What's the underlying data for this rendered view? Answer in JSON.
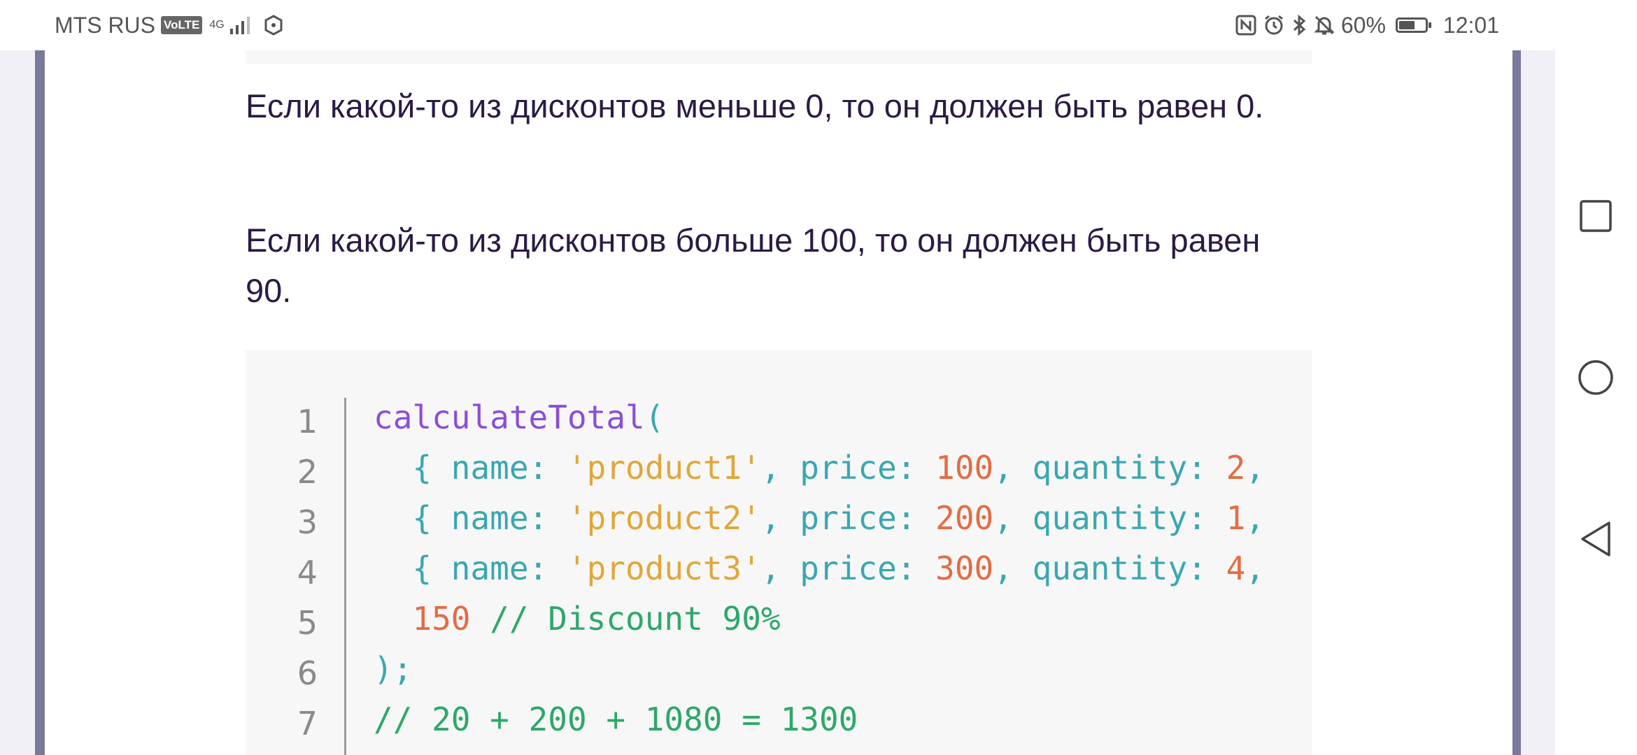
{
  "status_bar": {
    "carrier": "MTS RUS",
    "volte": "VoLTE",
    "network": "4G",
    "battery_percent": "60%",
    "battery_level": 0.6,
    "time": "12:01"
  },
  "article": {
    "paragraph1": "Если какой-то из дисконтов меньше 0, то он должен быть равен 0.",
    "paragraph2": "Если какой-то из дисконтов больше 100, то он должен быть равен 90."
  },
  "code": {
    "line_numbers": [
      "1",
      "2",
      "3",
      "4",
      "5",
      "6",
      "7"
    ],
    "line1": {
      "fn": "calculateTotal",
      "open": "("
    },
    "line2": {
      "brace": "{ name: ",
      "str": "'product1'",
      "mid": ", price: ",
      "price": "100",
      "mid2": ", quantity: ",
      "qty": "2",
      "end": ","
    },
    "line3": {
      "brace": "{ name: ",
      "str": "'product2'",
      "mid": ", price: ",
      "price": "200",
      "mid2": ", quantity: ",
      "qty": "1",
      "end": ","
    },
    "line4": {
      "brace": "{ name: ",
      "str": "'product3'",
      "mid": ", price: ",
      "price": "300",
      "mid2": ", quantity: ",
      "qty": "4",
      "end": ","
    },
    "line5": {
      "num": "150",
      "comment": " // Discount 90%"
    },
    "line6": {
      "close": ");"
    },
    "line7": {
      "comment": "// 20 + 200 + 1080 = 1300"
    }
  },
  "nav": {
    "icons": [
      "recent-apps-icon",
      "home-icon",
      "back-icon"
    ]
  },
  "colors": {
    "text": "#2b1b44",
    "code_bg": "#f7f7f7",
    "page_bg": "#f1f0f6",
    "stripe": "#7a7a9a",
    "fn": "#8b4fd6",
    "punctuation": "#3aa7b0",
    "string": "#e0a73a",
    "number": "#e46c43",
    "comment": "#2ea86a"
  }
}
